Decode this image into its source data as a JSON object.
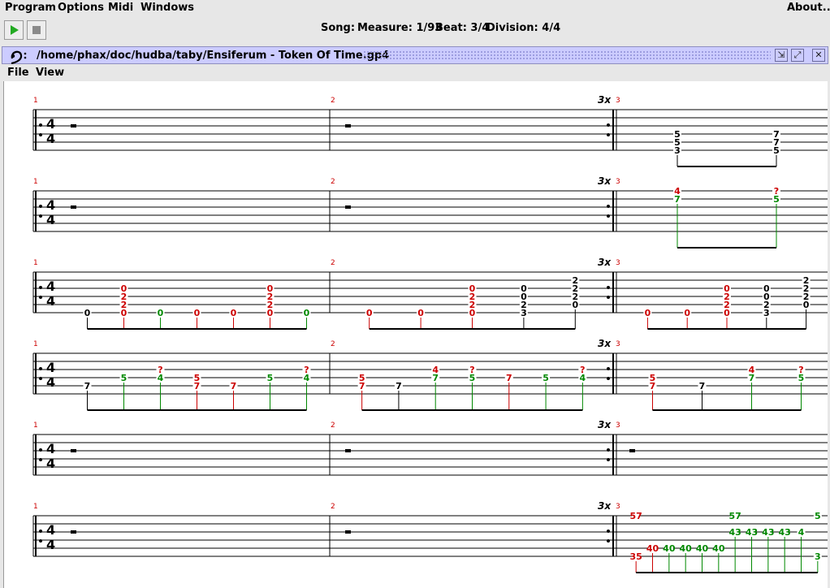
{
  "menu": {
    "program": "Program",
    "options": "Options",
    "midi": "Midi",
    "windows": "Windows",
    "about": "About..."
  },
  "toolbar": {
    "song_label": "Song:",
    "measure": "Measure: 1/93",
    "beat": "Beat: 3/4",
    "division": "Division: 4/4"
  },
  "window": {
    "title": "/home/phax/doc/hudba/taby/Ensiferum - Token Of Time.gp4",
    "min_icon": "⇲",
    "max_icon": "⤢",
    "close_icon": "✕"
  },
  "window_menu": {
    "file": "File",
    "view": "View"
  },
  "time_signature": {
    "top": "4",
    "bottom": "4"
  },
  "repeat_label": "3x",
  "systems": [
    {
      "measure_numbers": [
        "1",
        "2",
        "3"
      ],
      "m1": [],
      "m2": [],
      "m3": [
        {
          "s": 4,
          "t": "5",
          "c": "k"
        },
        {
          "s": 5,
          "t": "5",
          "c": "k"
        },
        {
          "s": 6,
          "t": "3",
          "c": "k"
        },
        {
          "s": 4,
          "t": "7",
          "c": "k"
        },
        {
          "s": 5,
          "t": "7",
          "c": "k"
        },
        {
          "s": 6,
          "t": "5",
          "c": "k"
        }
      ]
    },
    {
      "measure_numbers": [
        "1",
        "2",
        "3"
      ],
      "m1": [],
      "m2": [],
      "m3": [
        {
          "s": 1,
          "t": "4",
          "c": "r"
        },
        {
          "s": 2,
          "t": "7",
          "c": "g"
        },
        {
          "s": 1,
          "t": "?",
          "c": "r"
        },
        {
          "s": 2,
          "t": "5",
          "c": "g"
        }
      ]
    },
    {
      "measure_numbers": [
        "1",
        "2",
        "3"
      ],
      "m1": [
        {
          "s": 6,
          "t": "0",
          "c": "k"
        },
        {
          "s": 3,
          "t": "0",
          "c": "r"
        },
        {
          "s": 4,
          "t": "2",
          "c": "r"
        },
        {
          "s": 5,
          "t": "2",
          "c": "r"
        },
        {
          "s": 6,
          "t": "0",
          "c": "r"
        },
        {
          "s": 6,
          "t": "0",
          "c": "g"
        },
        {
          "s": 6,
          "t": "0",
          "c": "r"
        },
        {
          "s": 6,
          "t": "0",
          "c": "r"
        },
        {
          "s": 3,
          "t": "0",
          "c": "r"
        },
        {
          "s": 4,
          "t": "2",
          "c": "r"
        },
        {
          "s": 5,
          "t": "2",
          "c": "r"
        },
        {
          "s": 6,
          "t": "0",
          "c": "r"
        },
        {
          "s": 6,
          "t": "0",
          "c": "g"
        }
      ],
      "m2": [
        {
          "s": 6,
          "t": "0",
          "c": "r"
        },
        {
          "s": 6,
          "t": "0",
          "c": "r"
        },
        {
          "s": 3,
          "t": "0",
          "c": "r"
        },
        {
          "s": 4,
          "t": "2",
          "c": "r"
        },
        {
          "s": 5,
          "t": "2",
          "c": "r"
        },
        {
          "s": 6,
          "t": "0",
          "c": "r"
        },
        {
          "s": 3,
          "t": "0",
          "c": "k"
        },
        {
          "s": 4,
          "t": "0",
          "c": "k"
        },
        {
          "s": 5,
          "t": "2",
          "c": "k"
        },
        {
          "s": 6,
          "t": "3",
          "c": "k"
        },
        {
          "s": 2,
          "t": "2",
          "c": "k"
        },
        {
          "s": 3,
          "t": "2",
          "c": "k"
        },
        {
          "s": 4,
          "t": "2",
          "c": "k"
        },
        {
          "s": 5,
          "t": "0",
          "c": "k"
        }
      ],
      "m3": [
        {
          "s": 6,
          "t": "0",
          "c": "r"
        },
        {
          "s": 6,
          "t": "0",
          "c": "r"
        },
        {
          "s": 3,
          "t": "0",
          "c": "r"
        },
        {
          "s": 4,
          "t": "2",
          "c": "r"
        },
        {
          "s": 5,
          "t": "2",
          "c": "r"
        },
        {
          "s": 6,
          "t": "0",
          "c": "r"
        },
        {
          "s": 3,
          "t": "0",
          "c": "k"
        },
        {
          "s": 4,
          "t": "0",
          "c": "k"
        },
        {
          "s": 5,
          "t": "2",
          "c": "k"
        },
        {
          "s": 6,
          "t": "3",
          "c": "k"
        },
        {
          "s": 2,
          "t": "2",
          "c": "k"
        },
        {
          "s": 3,
          "t": "2",
          "c": "k"
        },
        {
          "s": 4,
          "t": "2",
          "c": "k"
        },
        {
          "s": 5,
          "t": "0",
          "c": "k"
        }
      ]
    },
    {
      "measure_numbers": [
        "1",
        "2",
        "3"
      ],
      "m1": [
        {
          "s": 5,
          "t": "7",
          "c": "k"
        },
        {
          "s": 4,
          "t": "5",
          "c": "g"
        },
        {
          "s": 3,
          "t": "?",
          "c": "r"
        },
        {
          "s": 4,
          "t": "4",
          "c": "g"
        },
        {
          "s": 4,
          "t": "5",
          "c": "r"
        },
        {
          "s": 5,
          "t": "7",
          "c": "r"
        },
        {
          "s": 5,
          "t": "7",
          "c": "r"
        },
        {
          "s": 4,
          "t": "5",
          "c": "g"
        },
        {
          "s": 3,
          "t": "?",
          "c": "r"
        },
        {
          "s": 4,
          "t": "4",
          "c": "g"
        }
      ],
      "m2": [
        {
          "s": 4,
          "t": "5",
          "c": "r"
        },
        {
          "s": 5,
          "t": "7",
          "c": "r"
        },
        {
          "s": 5,
          "t": "7",
          "c": "k"
        },
        {
          "s": 3,
          "t": "4",
          "c": "r"
        },
        {
          "s": 4,
          "t": "7",
          "c": "g"
        },
        {
          "s": 3,
          "t": "?",
          "c": "r"
        },
        {
          "s": 4,
          "t": "5",
          "c": "g"
        },
        {
          "s": 4,
          "t": "7",
          "c": "r"
        },
        {
          "s": 4,
          "t": "5",
          "c": "g"
        },
        {
          "s": 3,
          "t": "?",
          "c": "r"
        },
        {
          "s": 4,
          "t": "4",
          "c": "g"
        }
      ],
      "m3": [
        {
          "s": 4,
          "t": "5",
          "c": "r"
        },
        {
          "s": 5,
          "t": "7",
          "c": "r"
        },
        {
          "s": 5,
          "t": "7",
          "c": "k"
        },
        {
          "s": 3,
          "t": "4",
          "c": "r"
        },
        {
          "s": 4,
          "t": "7",
          "c": "g"
        },
        {
          "s": 3,
          "t": "?",
          "c": "r"
        },
        {
          "s": 4,
          "t": "5",
          "c": "g"
        }
      ]
    },
    {
      "measure_numbers": [
        "1",
        "2",
        "3"
      ],
      "m1": [],
      "m2": [],
      "m3": []
    },
    {
      "measure_numbers": [
        "1",
        "2",
        "3"
      ],
      "m1": [],
      "m2": [],
      "m3": [
        {
          "s": 1,
          "t": "57",
          "c": "r"
        },
        {
          "s": 6,
          "t": "35",
          "c": "r"
        },
        {
          "s": 5,
          "t": "40",
          "c": "r"
        },
        {
          "s": 5,
          "t": "40",
          "c": "g"
        },
        {
          "s": 5,
          "t": "40",
          "c": "g"
        },
        {
          "s": 5,
          "t": "40",
          "c": "g"
        },
        {
          "s": 5,
          "t": "40",
          "c": "g"
        },
        {
          "s": 1,
          "t": "57",
          "c": "g"
        },
        {
          "s": 3,
          "t": "43",
          "c": "g"
        },
        {
          "s": 3,
          "t": "43",
          "c": "g"
        },
        {
          "s": 3,
          "t": "43",
          "c": "g"
        },
        {
          "s": 3,
          "t": "43",
          "c": "g"
        },
        {
          "s": 3,
          "t": "4",
          "c": "g"
        },
        {
          "s": 1,
          "t": "5",
          "c": "g"
        },
        {
          "s": 6,
          "t": "3",
          "c": "g"
        }
      ]
    }
  ],
  "colors": {
    "red": "#cc0000",
    "green": "#008800",
    "black": "#000000",
    "titlebar": "#ccccff",
    "play": "#22aa22"
  }
}
